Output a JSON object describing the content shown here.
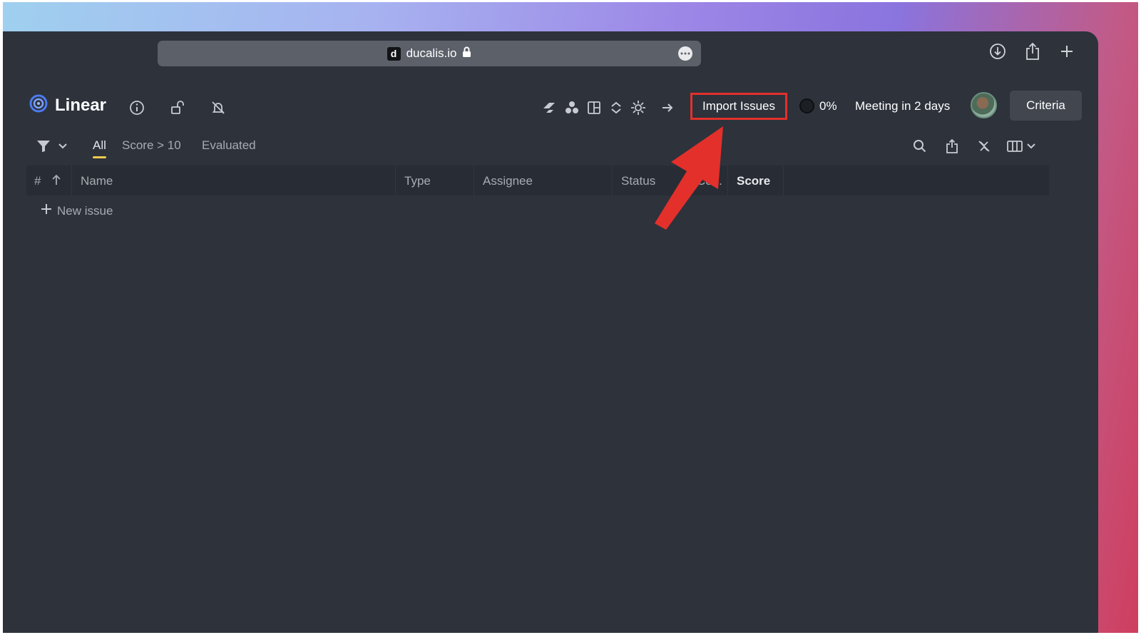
{
  "browser": {
    "url": "ducalis.io",
    "favicon_letter": "d",
    "icons": [
      "lock-icon",
      "more-icon",
      "download-icon",
      "share-icon",
      "new-tab-icon"
    ]
  },
  "header": {
    "app_name": "Linear",
    "import_label": "Import Issues",
    "progress_label": "0%",
    "meeting_label": "Meeting in 2 days",
    "criteria_label": "Criteria"
  },
  "tabs": [
    {
      "label": "All",
      "active": true
    },
    {
      "label": "Score > 10",
      "active": false
    },
    {
      "label": "Evaluated",
      "active": false
    }
  ],
  "table": {
    "columns": {
      "num": "#",
      "name": "Name",
      "type": "Type",
      "assignee": "Assignee",
      "status": "Status",
      "truncated": "Co...",
      "score": "Score"
    },
    "new_issue_label": "New issue"
  },
  "colors": {
    "accent_yellow": "#f2c94c",
    "highlight_red": "#e3302b",
    "app_bg": "#2d323b"
  }
}
